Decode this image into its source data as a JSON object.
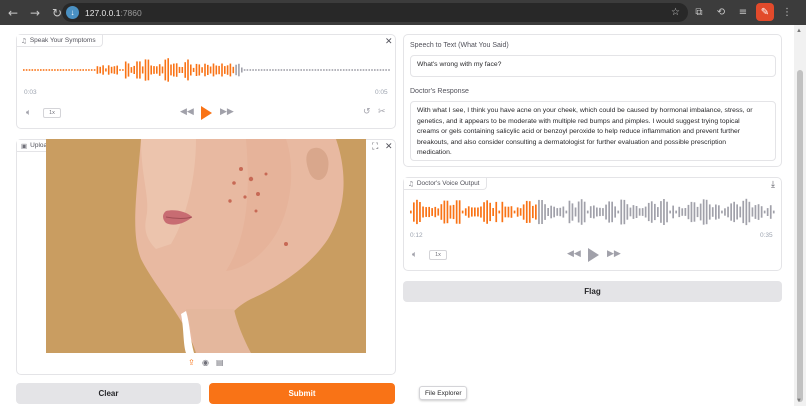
{
  "browser": {
    "url_host": "127.0.0.1",
    "url_port": ":7860"
  },
  "symptoms_audio": {
    "label": "Speak Your Symptoms",
    "time_current": "0:03",
    "time_total": "0:05",
    "speed": "1x"
  },
  "image_upload": {
    "label": "Upload an Affected Area Image"
  },
  "stt": {
    "label": "Speech to Text (What You Said)",
    "value": "What's wrong with my face?"
  },
  "response": {
    "label": "Doctor's Response",
    "lines": [
      "With what I see, I think you have acne on your cheek, which could be caused by hormonal imbalance, stress, or",
      "genetics, and it appears to be moderate with multiple red bumps and pimples. I would suggest trying topical",
      "creams or gels containing salicylic acid or benzoyl peroxide to help reduce inflammation and prevent further",
      "breakouts, and also consider consulting a dermatologist for further evaluation and possible prescription",
      "medication."
    ]
  },
  "voice_output": {
    "label": "Doctor's Voice Output",
    "time_current": "0:12",
    "time_total": "0:35",
    "speed": "1x"
  },
  "buttons": {
    "flag": "Flag",
    "clear": "Clear",
    "submit": "Submit"
  },
  "tooltip": "File Explorer",
  "colors": {
    "accent": "#f97316",
    "wave_played": "#f97316",
    "wave_unplayed": "#a1a1aa"
  }
}
